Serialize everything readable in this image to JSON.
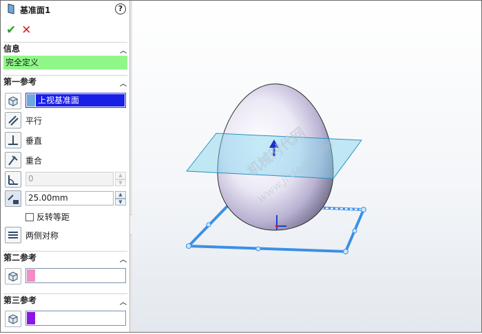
{
  "feature": {
    "title": "基准面1",
    "help": "?"
  },
  "actions": {
    "ok": "✔",
    "cancel": "✕"
  },
  "info": {
    "header": "信息",
    "status": "完全定义"
  },
  "first_ref": {
    "header": "第一参考",
    "selection": "上视基准面",
    "selection_color": "#1a1fe6",
    "options": {
      "parallel": "平行",
      "perpendicular": "垂直",
      "coincident": "重合"
    },
    "angle_value": "0",
    "offset_value": "25.00mm",
    "flip_offset": "反转等距",
    "mid_plane": "两侧对称"
  },
  "second_ref": {
    "header": "第二参考",
    "selection": "",
    "selection_color": "#f48cc5"
  },
  "third_ref": {
    "header": "第三参考",
    "selection": "",
    "selection_color": "#8a17e8"
  },
  "viewport": {
    "watermark_top": "机械时代网",
    "watermark_url": "www.jixiage.com"
  }
}
